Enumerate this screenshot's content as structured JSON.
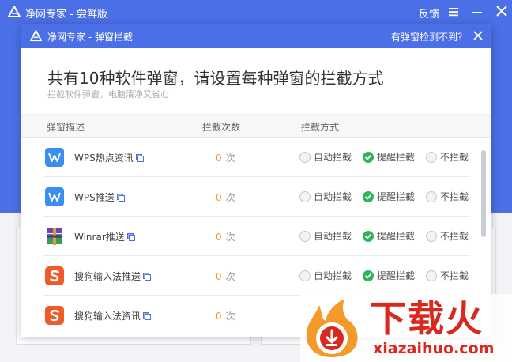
{
  "main_window": {
    "title": "净网专家 - 尝鲜版",
    "feedback_label": "反馈"
  },
  "dialog": {
    "title": "净网专家 - 弹窗拦截",
    "help_link": "有弹窗检测不到？",
    "headline": "共有10种软件弹窗，请设置每种弹窗的拦截方式",
    "subline": "拦截软件弹窗，电脑清净又省心",
    "columns": {
      "description": "弹窗描述",
      "count": "拦截次数",
      "method": "拦截方式"
    },
    "count_unit": "次",
    "options": {
      "auto": "自动拦截",
      "remind": "提醒拦截",
      "none": "不拦截"
    },
    "rows": [
      {
        "name": "WPS热点资讯",
        "count": "0",
        "icon": "wps-icon",
        "selected": "remind"
      },
      {
        "name": "WPS推送",
        "count": "0",
        "icon": "wps-icon",
        "selected": "remind"
      },
      {
        "name": "Winrar推送",
        "count": "0",
        "icon": "winrar-icon",
        "selected": "remind"
      },
      {
        "name": "搜狗输入法推送",
        "count": "0",
        "icon": "sogou-icon",
        "selected": "remind"
      },
      {
        "name": "搜狗输入法资讯",
        "count": "0",
        "icon": "sogou-icon",
        "selected": "remind"
      }
    ]
  },
  "watermark": {
    "title": "下载火",
    "url": "xiazaihuo.com"
  },
  "colors": {
    "brand_blue": "#4b6fe6",
    "checked_green": "#2fb457",
    "count_orange": "#f19a3e",
    "watermark_red": "#d9281d"
  }
}
